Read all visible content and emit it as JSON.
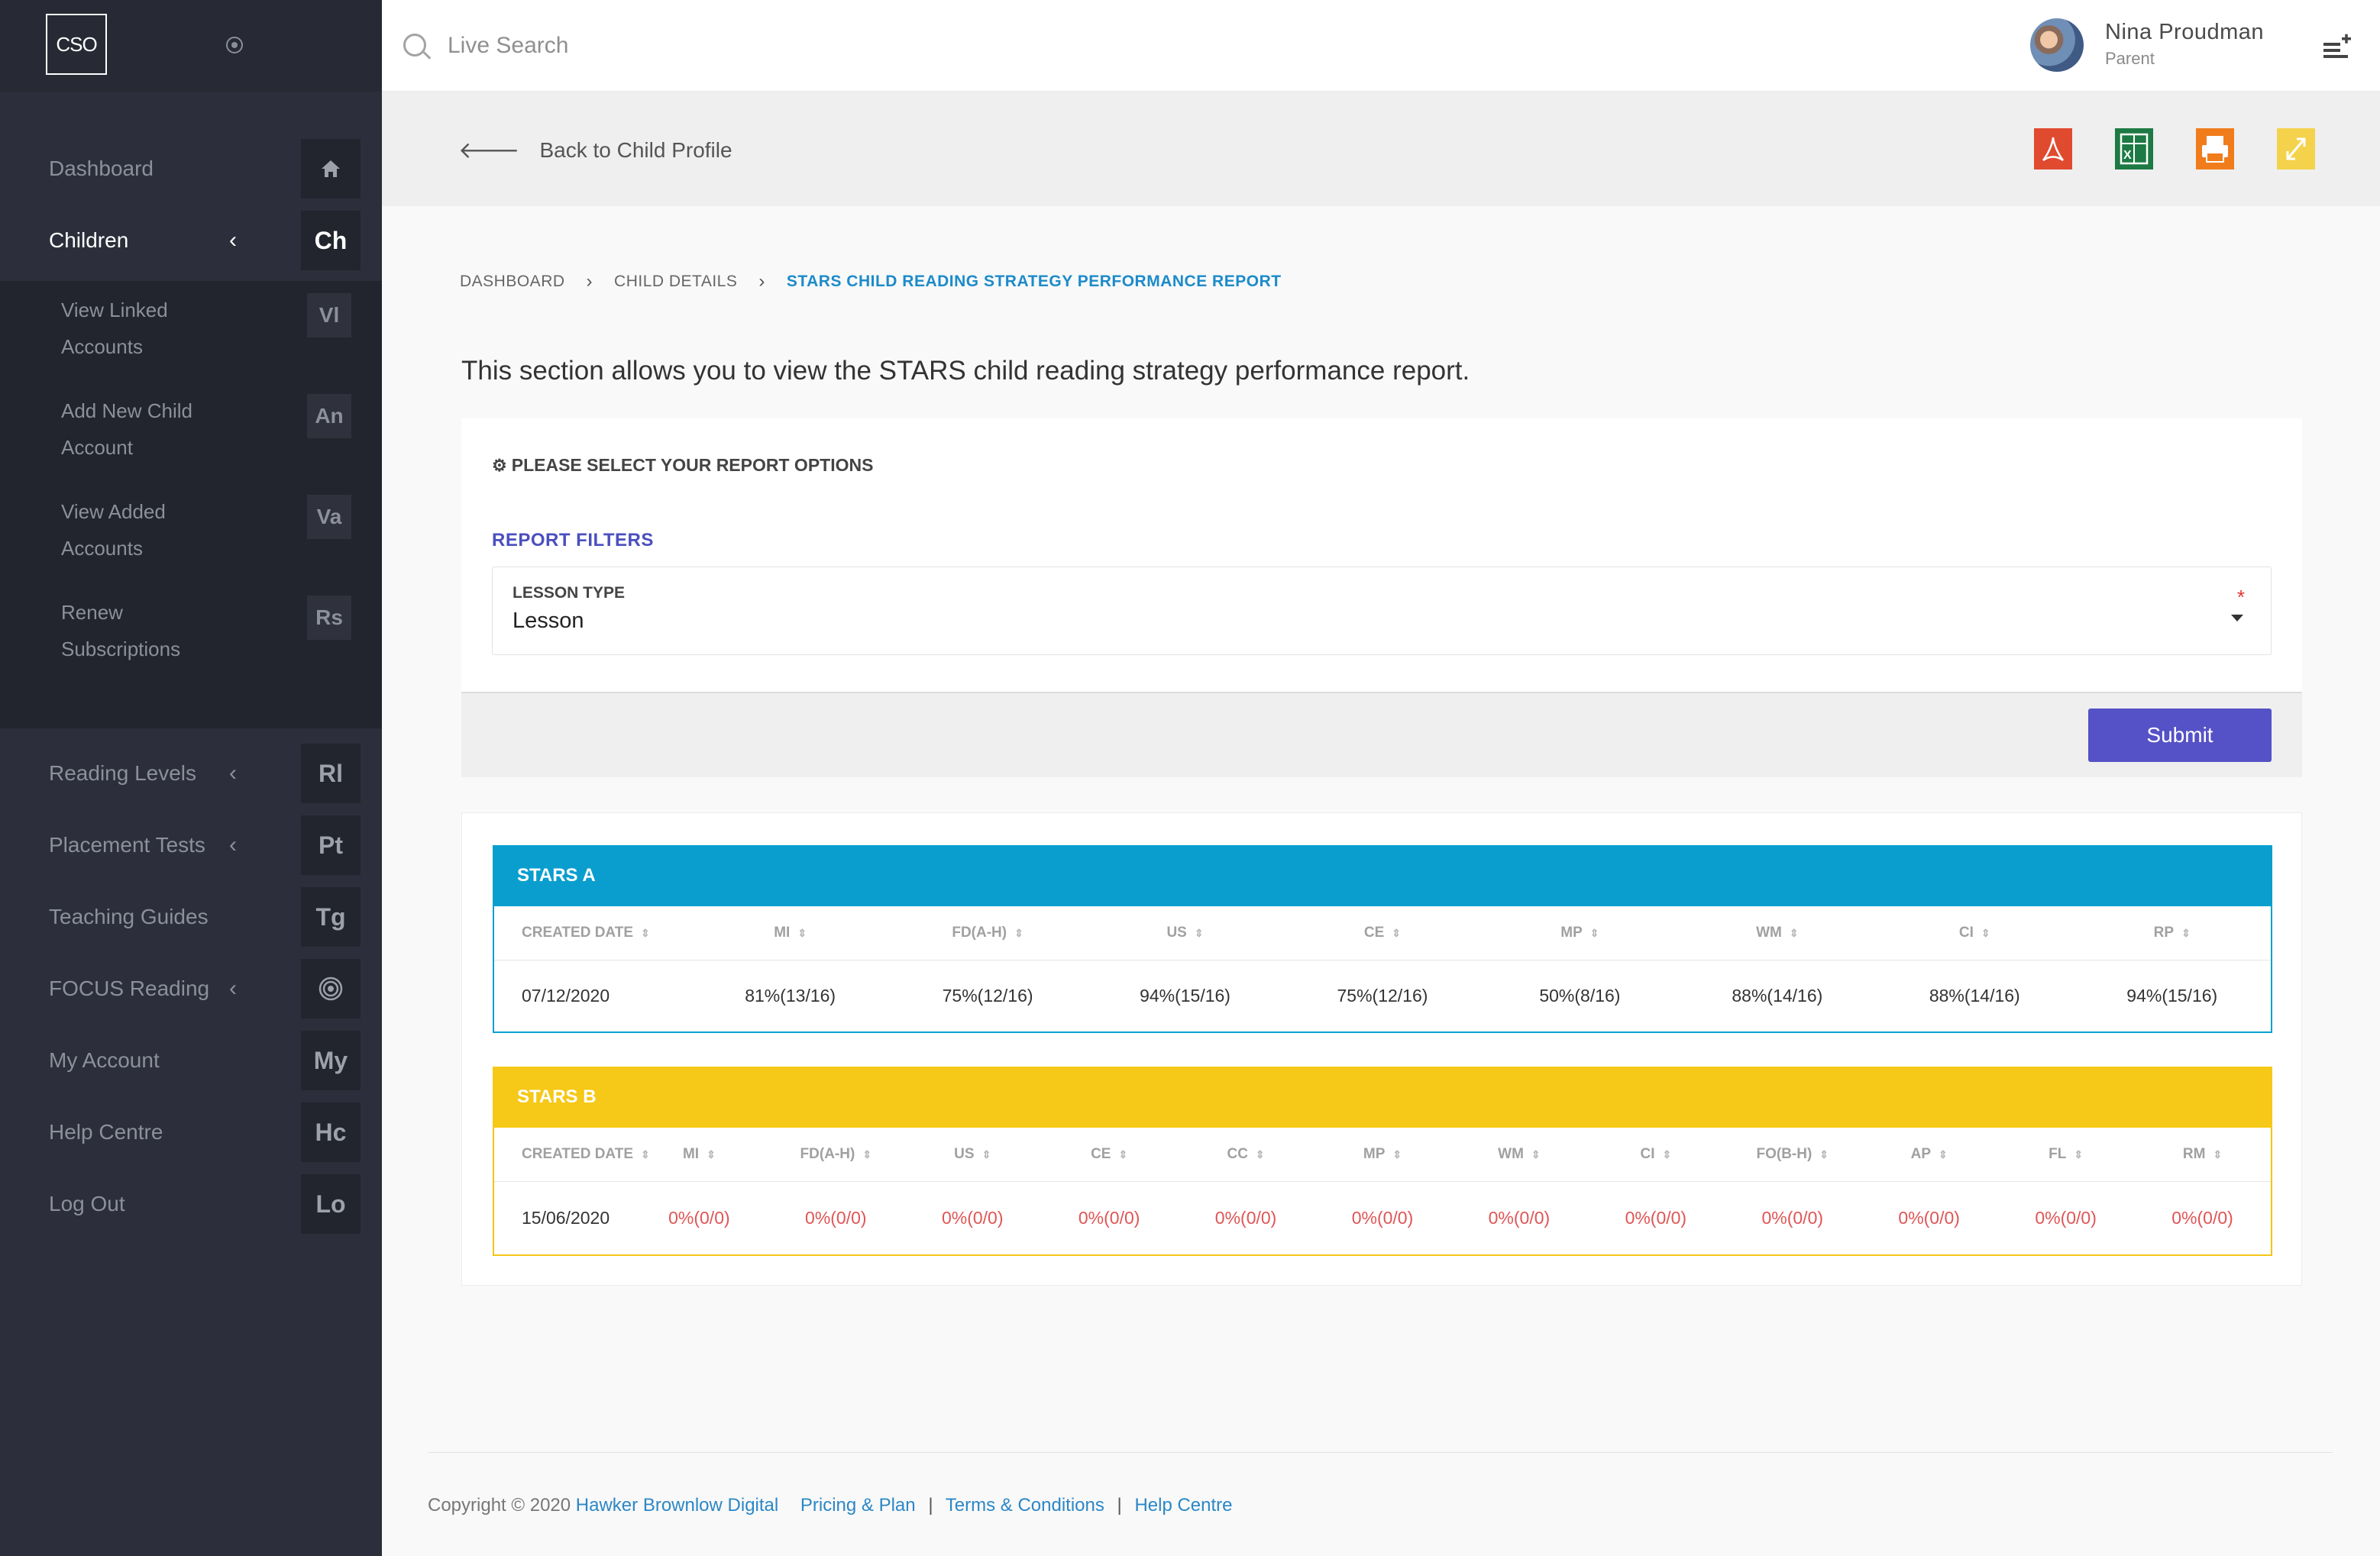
{
  "brand": {
    "logo_text": "CSO"
  },
  "sidebar": {
    "items": [
      {
        "label": "Dashboard",
        "abbr": "",
        "icon": "home-icon"
      },
      {
        "label": "Children",
        "abbr": "Ch",
        "chevron": "‹"
      },
      {
        "label": "Reading Levels",
        "abbr": "Rl",
        "chevron": "‹"
      },
      {
        "label": "Placement Tests",
        "abbr": "Pt",
        "chevron": "‹"
      },
      {
        "label": "Teaching Guides",
        "abbr": "Tg"
      },
      {
        "label": "FOCUS Reading",
        "abbr": "",
        "icon": "target-icon",
        "chevron": "‹"
      },
      {
        "label": "My Account",
        "abbr": "My"
      },
      {
        "label": "Help Centre",
        "abbr": "Hc"
      },
      {
        "label": "Log Out",
        "abbr": "Lo"
      }
    ],
    "children_sub": [
      {
        "label": "View Linked Accounts",
        "abbr": "Vl"
      },
      {
        "label": "Add New Child Account",
        "abbr": "An"
      },
      {
        "label": "View Added Accounts",
        "abbr": "Va"
      },
      {
        "label": "Renew Subscriptions",
        "abbr": "Rs"
      }
    ]
  },
  "topbar": {
    "search_placeholder": "Live Search",
    "user_name": "Nina Proudman",
    "user_role": "Parent"
  },
  "subheader": {
    "back_label": "Back to Child Profile",
    "export_buttons": [
      "pdf-icon",
      "excel-icon",
      "print-icon",
      "expand-icon"
    ]
  },
  "breadcrumb": [
    "DASHBOARD",
    "CHILD DETAILS",
    "STARS CHILD READING STRATEGY PERFORMANCE REPORT"
  ],
  "intro": "This section allows you to view the STARS child reading strategy performance report.",
  "options": {
    "title": "PLEASE SELECT YOUR REPORT OPTIONS",
    "filters_title": "REPORT FILTERS",
    "lesson_type_label": "LESSON TYPE",
    "lesson_type_value": "Lesson",
    "required_mark": "*",
    "submit_label": "Submit"
  },
  "stars_a": {
    "title": "STARS A",
    "columns": [
      "CREATED DATE",
      "MI",
      "FD(A-H)",
      "US",
      "CE",
      "MP",
      "WM",
      "CI",
      "RP"
    ],
    "rows": [
      [
        "07/12/2020",
        "81%(13/16)",
        "75%(12/16)",
        "94%(15/16)",
        "75%(12/16)",
        "50%(8/16)",
        "88%(14/16)",
        "88%(14/16)",
        "94%(15/16)"
      ]
    ]
  },
  "stars_b": {
    "title": "STARS B",
    "columns": [
      "CREATED DATE",
      "MI",
      "FD(A-H)",
      "US",
      "CE",
      "CC",
      "MP",
      "WM",
      "CI",
      "FO(B-H)",
      "AP",
      "FL",
      "RM"
    ],
    "rows": [
      [
        "15/06/2020",
        "0%(0/0)",
        "0%(0/0)",
        "0%(0/0)",
        "0%(0/0)",
        "0%(0/0)",
        "0%(0/0)",
        "0%(0/0)",
        "0%(0/0)",
        "0%(0/0)",
        "0%(0/0)",
        "0%(0/0)",
        "0%(0/0)"
      ]
    ]
  },
  "footer": {
    "copyright": "Copyright © 2020",
    "company": "Hawker Brownlow Digital",
    "links": [
      "Pricing & Plan",
      "Terms & Conditions",
      "Help Centre"
    ]
  },
  "colors": {
    "sidebar_bg": "#2c2f3b",
    "accent_purple": "#5551c6",
    "stars_a_blue": "#0a9ecf",
    "stars_b_yellow": "#f6c817",
    "zero_red": "#e05555",
    "breadcrumb_current": "#1c8bc9"
  }
}
